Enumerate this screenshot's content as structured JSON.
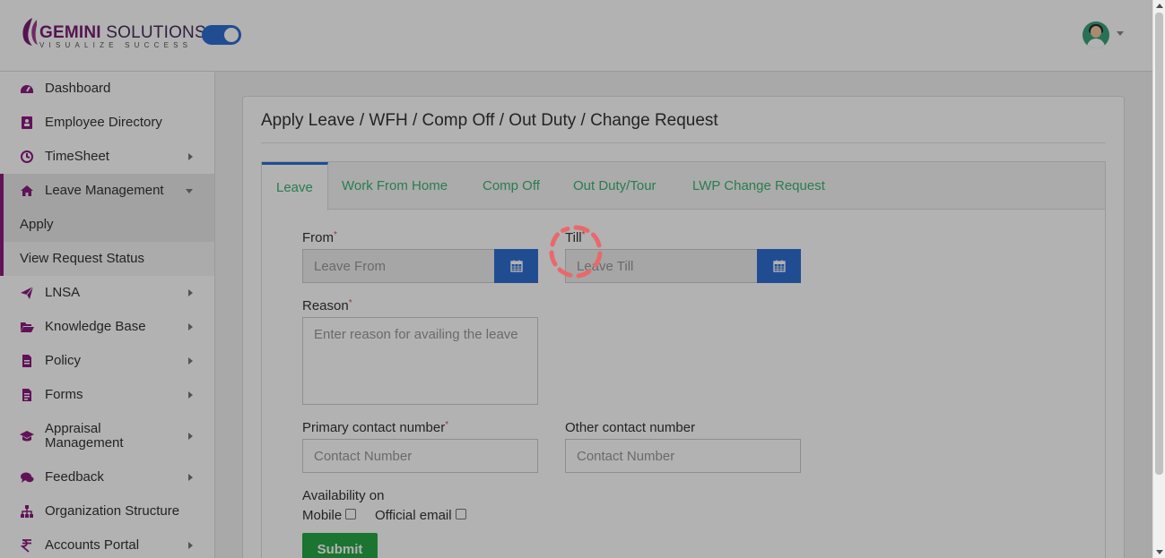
{
  "header": {
    "logo": {
      "name_bold": "GEMINI",
      "name_rest": " SOLUTIONS",
      "tagline": "VISUALIZE SUCCESS"
    },
    "theme_toggle": {
      "on": true
    },
    "user_avatar_icon": "avatar-icon",
    "colors": {
      "brand": "#7a1f73",
      "accent": "#2f6ed1"
    }
  },
  "sidebar": {
    "items": [
      {
        "label": "Dashboard",
        "icon": "dashboard-icon",
        "has_submenu": false
      },
      {
        "label": "Employee Directory",
        "icon": "address-book-icon",
        "has_submenu": false
      },
      {
        "label": "TimeSheet",
        "icon": "clock-icon",
        "has_submenu": true
      },
      {
        "label": "Leave Management",
        "icon": "home-icon",
        "has_submenu": true,
        "expanded": true
      },
      {
        "label": "Apply",
        "sub": true,
        "current": true
      },
      {
        "label": "View Request Status",
        "sub": true
      },
      {
        "label": "LNSA",
        "icon": "paper-plane-icon",
        "has_submenu": true
      },
      {
        "label": "Knowledge Base",
        "icon": "folder-open-icon",
        "has_submenu": true
      },
      {
        "label": "Policy",
        "icon": "file-icon",
        "has_submenu": true
      },
      {
        "label": "Forms",
        "icon": "file-text-icon",
        "has_submenu": true
      },
      {
        "label": "Appraisal Management",
        "icon": "graduation-cap-icon",
        "has_submenu": true
      },
      {
        "label": "Feedback",
        "icon": "comments-icon",
        "has_submenu": true
      },
      {
        "label": "Organization Structure",
        "icon": "sitemap-icon",
        "has_submenu": false
      },
      {
        "label": "Accounts Portal",
        "icon": "rupee-icon",
        "has_submenu": true
      }
    ]
  },
  "main": {
    "title": "Apply Leave / WFH / Comp Off / Out Duty / Change Request",
    "tabs": [
      {
        "label": "Leave",
        "active": true
      },
      {
        "label": "Work From Home"
      },
      {
        "label": "Comp Off"
      },
      {
        "label": "Out Duty/Tour"
      },
      {
        "label": "LWP Change Request"
      }
    ],
    "form": {
      "from_label": "From",
      "from_placeholder": "Leave From",
      "till_label": "Till",
      "till_placeholder": "Leave Till",
      "required_mark": "*",
      "reason_label": "Reason",
      "reason_placeholder": "Enter reason for availing the leave",
      "primary_contact_label": "Primary contact number",
      "primary_contact_placeholder": "Contact Number",
      "other_contact_label": "Other contact number",
      "other_contact_placeholder": "Contact Number",
      "availability_label": "Availability on",
      "mobile_label": "Mobile",
      "mobile_checked": false,
      "official_email_label": "Official email",
      "official_email_checked": false,
      "submit_label": "Submit"
    }
  },
  "loading": {
    "visible": true,
    "spinner_color": "#e8696b"
  }
}
